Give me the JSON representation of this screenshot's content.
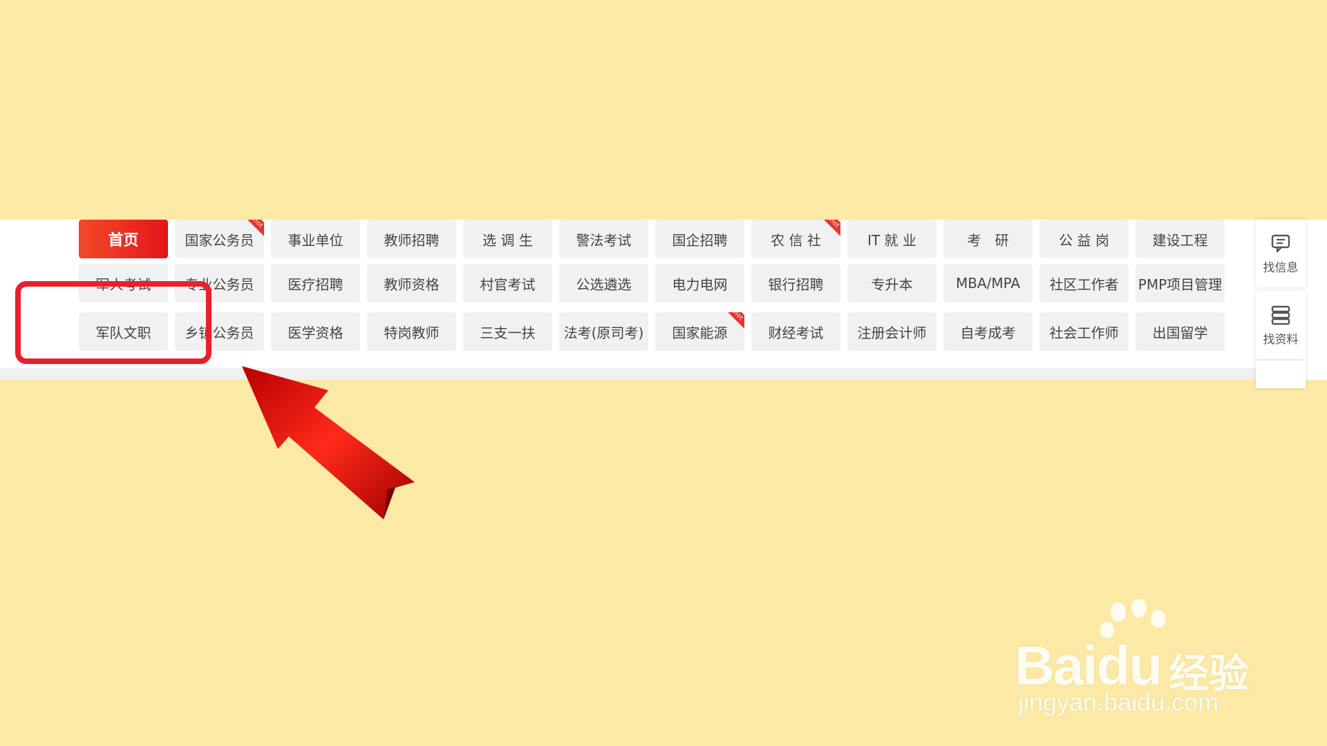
{
  "nav": {
    "rows": [
      [
        {
          "label": "首页",
          "home": true
        },
        {
          "label": "国家公务员",
          "hot": true
        },
        {
          "label": "事业单位"
        },
        {
          "label": "教师招聘"
        },
        {
          "label": "选 调 生"
        },
        {
          "label": "警法考试"
        },
        {
          "label": "国企招聘"
        },
        {
          "label": "农 信 社",
          "hot": true
        },
        {
          "label": "IT 就 业"
        },
        {
          "label": "考　研"
        },
        {
          "label": "公 益 岗"
        },
        {
          "label": "建设工程"
        }
      ],
      [
        {
          "label": "军人考试"
        },
        {
          "label": "专业公务员"
        },
        {
          "label": "医疗招聘"
        },
        {
          "label": "教师资格"
        },
        {
          "label": "村官考试"
        },
        {
          "label": "公选遴选"
        },
        {
          "label": "电力电网"
        },
        {
          "label": "银行招聘"
        },
        {
          "label": "专升本"
        },
        {
          "label": "MBA/MPA"
        },
        {
          "label": "社区工作者"
        },
        {
          "label": "PMP项目管理"
        }
      ],
      [
        {
          "label": "军队文职"
        },
        {
          "label": "乡镇公务员"
        },
        {
          "label": "医学资格"
        },
        {
          "label": "特岗教师"
        },
        {
          "label": "三支一扶"
        },
        {
          "label": "法考(原司考)"
        },
        {
          "label": "国家能源",
          "hot": true
        },
        {
          "label": "财经考试"
        },
        {
          "label": "注册会计师"
        },
        {
          "label": "自考成考"
        },
        {
          "label": "社会工作师"
        },
        {
          "label": "出国留学"
        }
      ]
    ],
    "hot_label": "hot"
  },
  "sidebar": {
    "find_info": "找信息",
    "find_material": "找资料"
  },
  "watermark": {
    "brand": "Baidu",
    "cn": "经验",
    "url": "jingyan.baidu.com"
  },
  "colors": {
    "background": "#fce9a5",
    "accent": "#e5151a",
    "highlight": "#e8202e"
  }
}
